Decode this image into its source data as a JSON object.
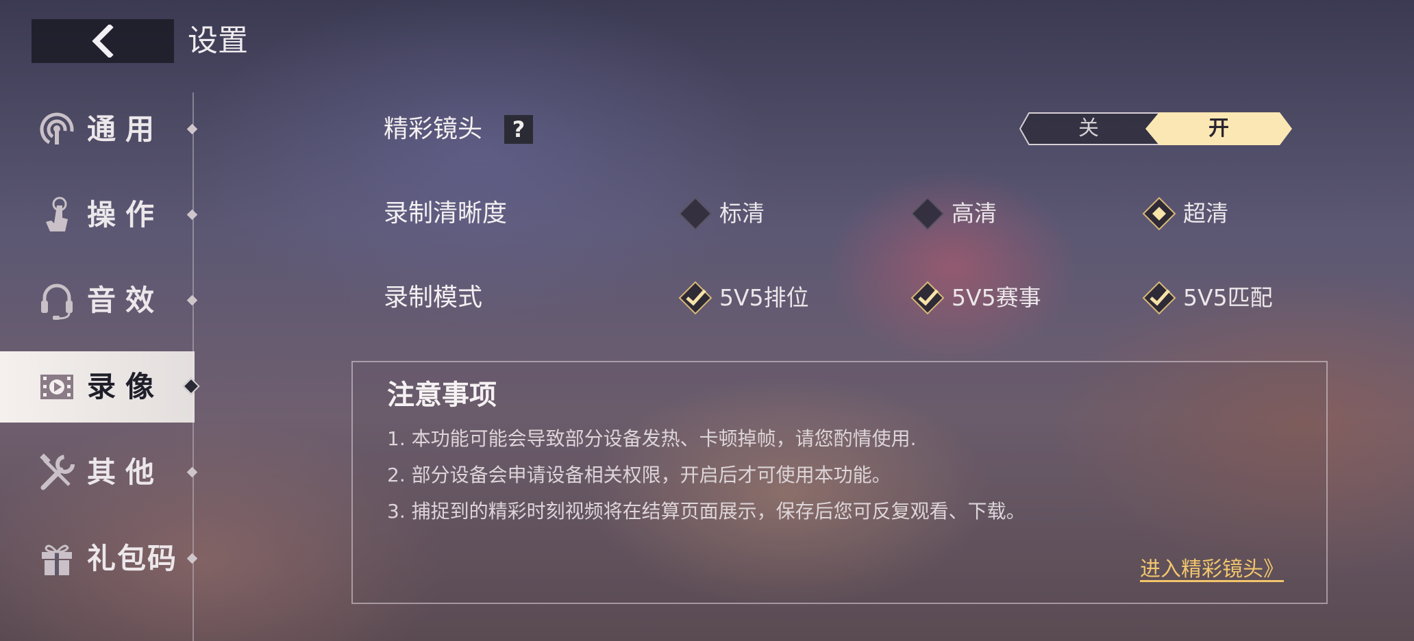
{
  "header": {
    "back_icon": "chevron-left-icon",
    "title": "设置"
  },
  "sidebar": {
    "items": [
      {
        "label": "通用",
        "icon": "signal-icon",
        "active": false
      },
      {
        "label": "操作",
        "icon": "hand-tap-icon",
        "active": false
      },
      {
        "label": "音效",
        "icon": "headset-icon",
        "active": false
      },
      {
        "label": "录像",
        "icon": "film-play-icon",
        "active": true
      },
      {
        "label": "其他",
        "icon": "tools-icon",
        "active": false
      },
      {
        "label": "礼包码",
        "icon": "gift-icon",
        "active": false
      }
    ]
  },
  "settings": {
    "highlight": {
      "label": "精彩镜头",
      "help": "?",
      "toggle_off": "关",
      "toggle_on": "开",
      "value": "开"
    },
    "quality": {
      "label": "录制清晰度",
      "options": [
        {
          "label": "标清",
          "selected": false
        },
        {
          "label": "高清",
          "selected": false
        },
        {
          "label": "超清",
          "selected": true
        }
      ]
    },
    "mode": {
      "label": "录制模式",
      "options": [
        {
          "label": "5V5排位",
          "checked": true
        },
        {
          "label": "5V5赛事",
          "checked": true
        },
        {
          "label": "5V5匹配",
          "checked": true
        }
      ]
    }
  },
  "notice": {
    "title": "注意事项",
    "lines": [
      "1. 本功能可能会导致部分设备发热、卡顿掉帧，请您酌情使用.",
      "2. 部分设备会申请设备相关权限，开启后才可使用本功能。",
      "3. 捕捉到的精彩时刻视频将在结算页面展示，保存后您可反复观看、下载。"
    ],
    "link": "进入精彩镜头》"
  },
  "colors": {
    "accent": "#f2c66e",
    "toggle_on_bg": "#fbe7b3",
    "panel_dark": "#2b2a38"
  }
}
